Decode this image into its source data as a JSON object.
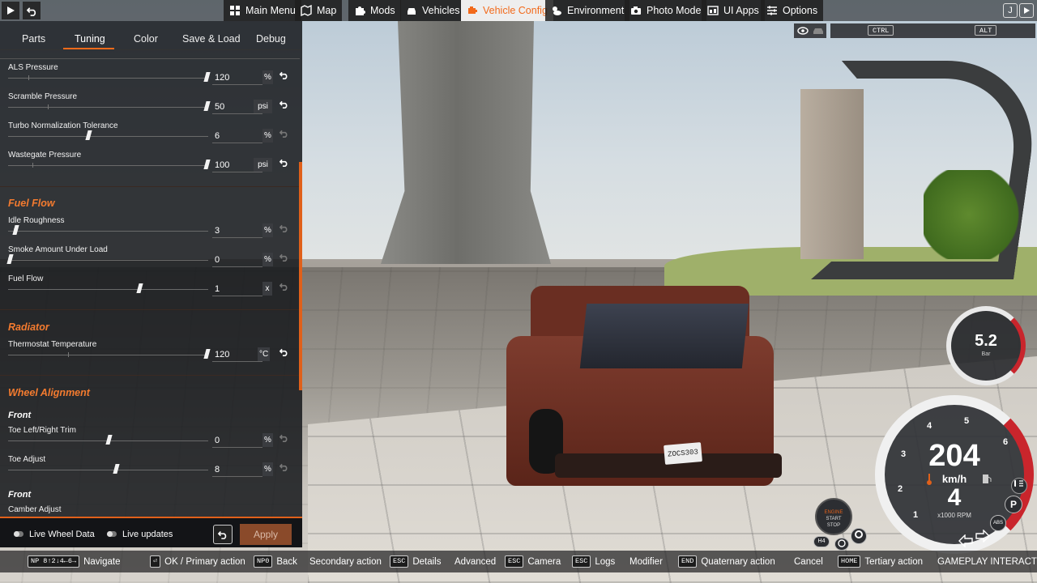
{
  "topbar": {
    "menu": [
      {
        "label": "Main Menu",
        "icon": "menu-grid-icon"
      },
      {
        "label": "Map",
        "icon": "map-icon"
      },
      {
        "label": "Mods",
        "icon": "puzzle-icon"
      },
      {
        "label": "Vehicles",
        "icon": "car-icon"
      },
      {
        "label": "Vehicle Config",
        "icon": "engine-icon",
        "active": true
      },
      {
        "label": "Environment",
        "icon": "weather-icon"
      },
      {
        "label": "Photo Mode",
        "icon": "camera-icon"
      },
      {
        "label": "UI Apps",
        "icon": "apps-icon"
      },
      {
        "label": "Options",
        "icon": "sliders-icon"
      }
    ]
  },
  "panel": {
    "tabs": [
      "Parts",
      "Tuning",
      "Color",
      "Save & Load",
      "Debug"
    ],
    "active_tab": "Tuning",
    "rows": [
      {
        "label": "ALS Pressure",
        "value": "120",
        "unit": "%",
        "level": 1.0,
        "default_level": 0.1,
        "reset_active": true
      },
      {
        "label": "Scramble Pressure",
        "value": "50",
        "unit": "psi",
        "level": 1.0,
        "default_level": 0.2,
        "reset_active": true
      },
      {
        "label": "Turbo Normalization Tolerance",
        "value": "6",
        "unit": "%",
        "level": 0.4,
        "default_level": 0.4,
        "reset_active": false
      },
      {
        "label": "Wastegate Pressure",
        "value": "100",
        "unit": "psi",
        "level": 1.0,
        "default_level": 0.12,
        "reset_active": true
      },
      {
        "label": "Idle Roughness",
        "value": "3",
        "unit": "%",
        "level": 0.03,
        "default_level": 0.03,
        "reset_active": false
      },
      {
        "label": "Smoke Amount Under Load",
        "value": "0",
        "unit": "%",
        "level": 0.0,
        "default_level": 0.0,
        "reset_active": false
      },
      {
        "label": "Fuel Flow",
        "value": "1",
        "unit": "x",
        "level": 0.66,
        "default_level": 0.66,
        "reset_active": false
      },
      {
        "label": "Thermostat Temperature",
        "value": "120",
        "unit": "°C",
        "level": 1.0,
        "default_level": 0.3,
        "reset_active": true
      },
      {
        "label": "Toe Left/Right Trim",
        "value": "0",
        "unit": "%",
        "level": 0.5,
        "default_level": 0.5,
        "reset_active": false
      },
      {
        "label": "Toe Adjust",
        "value": "8",
        "unit": "%",
        "level": 0.54,
        "default_level": 0.54,
        "reset_active": false
      }
    ],
    "sections": [
      "Fuel Flow",
      "Radiator",
      "Wheel Alignment"
    ],
    "subsections": [
      "Front",
      "Front"
    ],
    "partial_label": "Camber Adjust",
    "footer": {
      "live_wheel_data": "Live Wheel Data",
      "live_updates": "Live updates",
      "apply": "Apply"
    }
  },
  "hud": {
    "ctrl": "CTRL",
    "alt": "ALT",
    "boost": {
      "value": "5.2",
      "unit": "Bar"
    },
    "speed": {
      "value": "204",
      "unit": "km/h",
      "gear": "4",
      "rpm_label": "x1000 RPM",
      "ticks": [
        "1",
        "2",
        "3",
        "4",
        "5",
        "6"
      ]
    },
    "start_stop": {
      "line1": "ENGINE",
      "line2": "START",
      "line3": "STOP"
    },
    "plate": "ZOCS303",
    "parking": "P",
    "abs": "ABS",
    "h4": "H4"
  },
  "bottombar": [
    {
      "key": "NP 8↑2↓4←6→",
      "label": "Navigate"
    },
    {
      "key": "⏎",
      "label": "OK / Primary action"
    },
    {
      "key": "NP0",
      "label": "Back"
    },
    {
      "key": "",
      "label": "Secondary action"
    },
    {
      "key": "ESC",
      "label": "Details"
    },
    {
      "key": "",
      "label": "Advanced"
    },
    {
      "key": "ESC",
      "label": "Camera"
    },
    {
      "key": "ESC",
      "label": "Logs"
    },
    {
      "key": "",
      "label": "Modifier"
    },
    {
      "key": "END",
      "label": "Quaternary action"
    },
    {
      "key": "",
      "label": "Cancel"
    },
    {
      "key": "HOME",
      "label": "Tertiary action"
    },
    {
      "key": "",
      "label": "GAMEPLAY INTERACT"
    }
  ]
}
